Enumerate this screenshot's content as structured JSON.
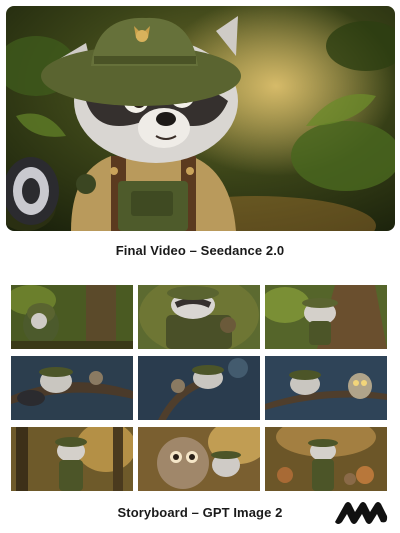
{
  "captions": {
    "final": "Final Video – Seedance 2.0",
    "storyboard": "Storyboard – GPT Image 2"
  },
  "logo": {
    "icon": "brand-w-logo-icon",
    "color": "#111111"
  },
  "storyboard": {
    "frames": [
      {
        "scene": "raccoon-walking-forest"
      },
      {
        "scene": "raccoon-closeup-backpack"
      },
      {
        "scene": "raccoon-climbing-tree"
      },
      {
        "scene": "raccoon-night-branch"
      },
      {
        "scene": "raccoon-night-forest"
      },
      {
        "scene": "raccoon-night-owl"
      },
      {
        "scene": "raccoon-sunset-forest"
      },
      {
        "scene": "owl-and-raccoon"
      },
      {
        "scene": "raccoon-with-animals"
      }
    ]
  }
}
